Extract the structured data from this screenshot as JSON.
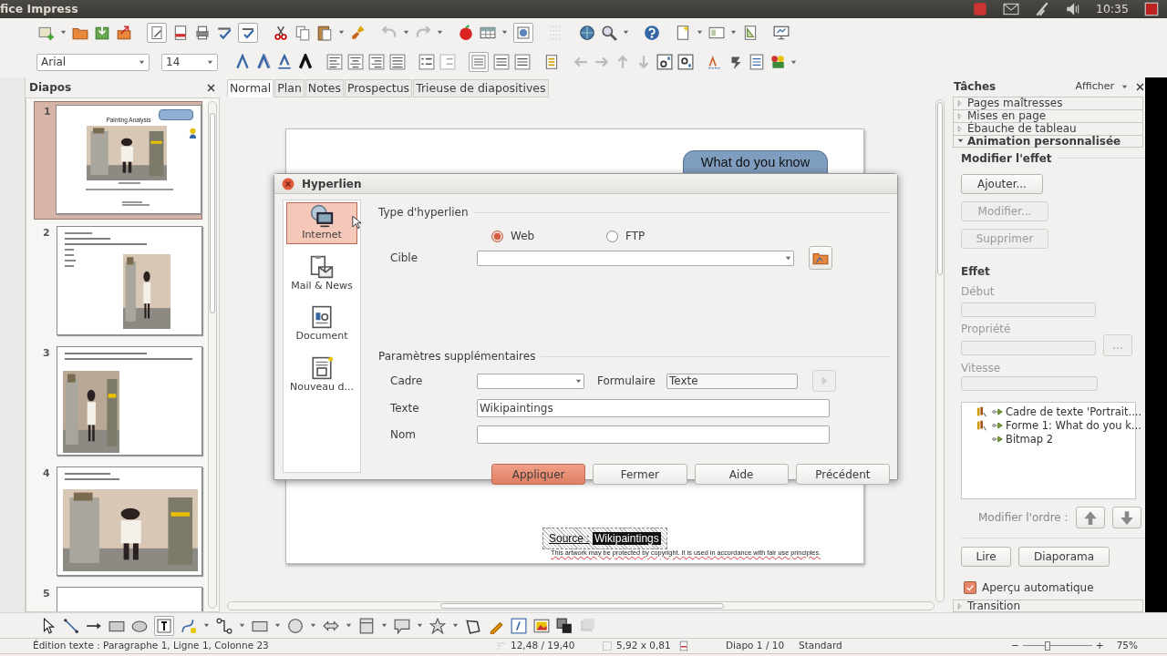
{
  "window": {
    "title": "fice Impress",
    "time": "10:35"
  },
  "formatting": {
    "font": "Arial",
    "size": "14"
  },
  "slides_panel": {
    "title": "Diapos",
    "slides": [
      {
        "number": "1",
        "selected": true,
        "kind": "title",
        "title": "Painting Analysis"
      },
      {
        "number": "2",
        "selected": false,
        "kind": "picture-right"
      },
      {
        "number": "3",
        "selected": false,
        "kind": "picture-left"
      },
      {
        "number": "4",
        "selected": false,
        "kind": "picture-wide"
      },
      {
        "number": "5",
        "selected": false,
        "kind": "text"
      }
    ]
  },
  "view_tabs": [
    {
      "label": "Normal",
      "selected": true
    },
    {
      "label": "Plan",
      "selected": false
    },
    {
      "label": "Notes",
      "selected": false
    },
    {
      "label": "Prospectus",
      "selected": false
    },
    {
      "label": "Trieuse de diapositives",
      "selected": false
    }
  ],
  "slide": {
    "callout": "What do you know",
    "source_label": "Source :",
    "source_link": "Wikipaintings",
    "notice": "This artwork may be protected by copyright. It is used in accordance with fair use principles."
  },
  "dialog": {
    "title": "Hyperlien",
    "categories": [
      {
        "label": "Internet",
        "selected": true
      },
      {
        "label": "Mail & News",
        "selected": false
      },
      {
        "label": "Document",
        "selected": false
      },
      {
        "label": "Nouveau d...",
        "selected": false
      }
    ],
    "type_heading": "Type d'hyperlien",
    "protocols": [
      {
        "label": "Web",
        "selected": true
      },
      {
        "label": "FTP",
        "selected": false
      }
    ],
    "target_label": "Cible",
    "extra_heading": "Paramètres supplémentaires",
    "frame_label": "Cadre",
    "form_label": "Formulaire",
    "form_value": "Texte",
    "text_label": "Texte",
    "text_value": "Wikipaintings",
    "name_label": "Nom",
    "buttons": [
      {
        "label": "Appliquer",
        "default": true
      },
      {
        "label": "Fermer",
        "default": false
      },
      {
        "label": "Aide",
        "default": false
      },
      {
        "label": "Précédent",
        "default": false
      }
    ]
  },
  "tasks": {
    "title": "Tâches",
    "view": "Afficher",
    "sections": [
      {
        "label": "Pages maîtresses",
        "expanded": false
      },
      {
        "label": "Mises en page",
        "expanded": false
      },
      {
        "label": "Ébauche de tableau",
        "expanded": false
      },
      {
        "label": "Animation personnalisée",
        "expanded": true
      }
    ],
    "modify_heading": "Modifier l'effet",
    "buttons": [
      {
        "label": "Ajouter...",
        "disabled": false
      },
      {
        "label": "Modifier...",
        "disabled": true
      },
      {
        "label": "Supprimer",
        "disabled": true
      }
    ],
    "effect_heading": "Effet",
    "fields": [
      {
        "label": "Début",
        "kind": "spin"
      },
      {
        "label": "Propriété",
        "kind": "spin-options"
      },
      {
        "label": "Vitesse",
        "kind": "combo"
      }
    ],
    "options_button": "...",
    "animations": [
      {
        "label": "Cadre de texte 'Portrait....",
        "trigger": true
      },
      {
        "label": "Forme 1: What do you k...",
        "trigger": true
      },
      {
        "label": "Bitmap 2",
        "trigger": false
      }
    ],
    "order_label": "Modifier l'ordre :",
    "play_buttons": [
      "Lire",
      "Diaporama"
    ],
    "auto_preview": {
      "label": "Aperçu automatique",
      "checked": true
    },
    "transition": {
      "label": "Transition",
      "expanded": false
    }
  },
  "status_bar": {
    "mode": "Édition texte : Paragraphe 1, Ligne 1, Colonne 23",
    "position": "12,48 / 19,40",
    "size": "5,92 x 0,81",
    "slide": "Diapo 1 / 10",
    "master": "Standard",
    "zoom_out": "−",
    "zoom_in": "+",
    "zoom_slider": {
      "level": 0.35
    },
    "zoom": "75%"
  }
}
